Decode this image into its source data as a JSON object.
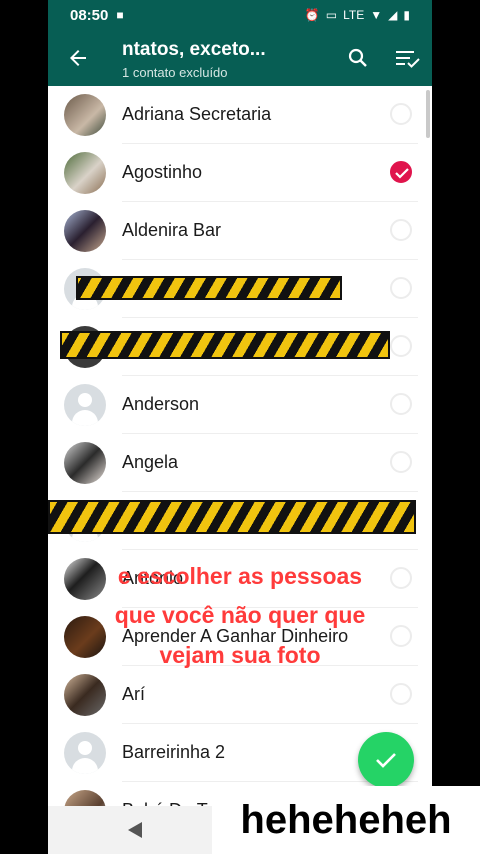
{
  "status_bar": {
    "time": "08:50",
    "network": "LTE"
  },
  "app_bar": {
    "title": "ntatos, exceto...",
    "subtitle": "1 contato excluído"
  },
  "contacts": [
    {
      "name": "Adriana Secretaria",
      "checked": false
    },
    {
      "name": "Agostinho",
      "checked": true
    },
    {
      "name": "Aldenira Bar",
      "checked": false
    },
    {
      "name": "",
      "checked": false
    },
    {
      "name": "",
      "checked": false
    },
    {
      "name": "Anderson",
      "checked": false
    },
    {
      "name": "Angela",
      "checked": false
    },
    {
      "name": "",
      "checked": false
    },
    {
      "name": "Antonio",
      "checked": false
    },
    {
      "name": "Aprender A Ganhar Dinheiro",
      "checked": false
    },
    {
      "name": "Arí",
      "checked": false
    },
    {
      "name": "Barreirinha 2",
      "checked": false
    },
    {
      "name": "Bebé De T",
      "checked": false
    }
  ],
  "overlay_text": {
    "line1": "e escolher as pessoas",
    "line2": "que você não quer que",
    "line3": "vejam sua foto"
  },
  "watermark": "heheheheh",
  "colors": {
    "header": "#075e54",
    "check": "#e0144c",
    "fab": "#25d366",
    "overlay_text": "#ff3b3b"
  }
}
